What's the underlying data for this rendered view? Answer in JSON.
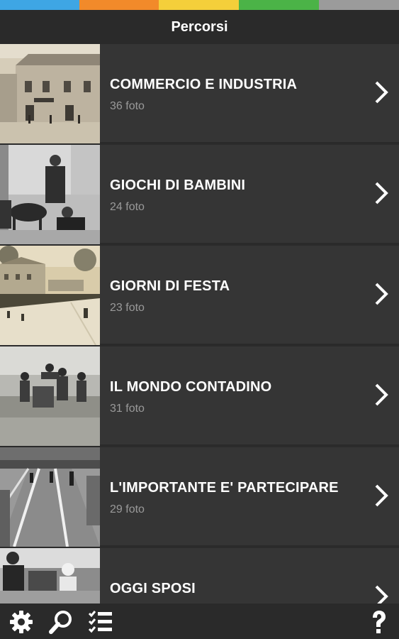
{
  "status_colors": [
    "#3ea6e4",
    "#f28a2a",
    "#f4cf3a",
    "#4bb347",
    "#9b9b9b"
  ],
  "header": {
    "title": "Percorsi"
  },
  "routes": [
    {
      "title": "COMMERCIO E INDUSTRIA",
      "count": "36 foto"
    },
    {
      "title": "GIOCHI DI BAMBINI",
      "count": "24 foto"
    },
    {
      "title": "GIORNI DI FESTA",
      "count": "23 foto"
    },
    {
      "title": "IL MONDO CONTADINO",
      "count": "31 foto"
    },
    {
      "title": "L'IMPORTANTE E' PARTECIPARE",
      "count": "29 foto"
    },
    {
      "title": "OGGI SPOSI",
      "count": ""
    }
  ],
  "bottom_bar": {
    "icons": [
      "gear-icon",
      "search-icon",
      "checklist-icon",
      "help-icon"
    ]
  }
}
